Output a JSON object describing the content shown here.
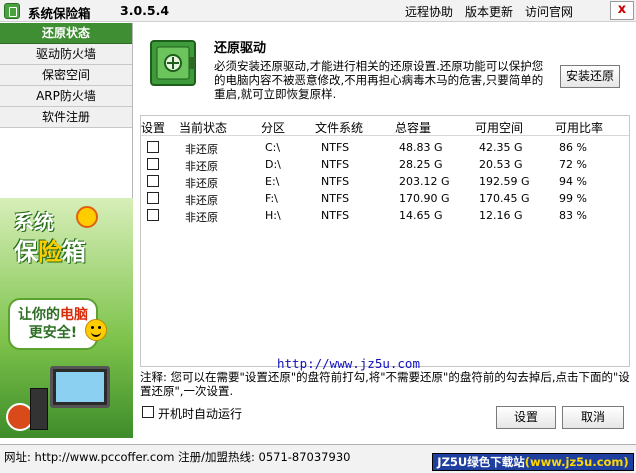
{
  "app": {
    "title": "系统保险箱",
    "version": "3.0.5.4",
    "links": [
      "远程协助",
      "版本更新",
      "访问官网"
    ],
    "close_label": "x"
  },
  "sidebar": {
    "items": [
      {
        "label": "还原状态",
        "active": true
      },
      {
        "label": "驱动防火墙",
        "active": false
      },
      {
        "label": "保密空间",
        "active": false
      },
      {
        "label": "ARP防火墙",
        "active": false
      },
      {
        "label": "软件注册",
        "active": false
      }
    ],
    "promo": {
      "title_line1": "系统",
      "title_line2_a": "保",
      "title_line2_b": "险",
      "title_line2_c": "箱",
      "slogan_line1_a": "让你的",
      "slogan_line1_b": "电脑",
      "slogan_line2": "更安全!"
    }
  },
  "main": {
    "heading": "还原驱动",
    "description": "必须安装还原驱动,才能进行相关的还原设置.还原功能可以保护您的电脑内容不被恶意修改,不用再担心病毒木马的危害,只要简单的重启,就可立即恢复原样.",
    "install_button": "安装还原",
    "table": {
      "headers": [
        "设置",
        "当前状态",
        "分区",
        "文件系统",
        "总容量",
        "可用空间",
        "可用比率"
      ],
      "rows": [
        {
          "checked": false,
          "status": "非还原",
          "drive": "C:\\",
          "fs": "NTFS",
          "total": "48.83 G",
          "free": "42.35 G",
          "ratio": "86 %"
        },
        {
          "checked": false,
          "status": "非还原",
          "drive": "D:\\",
          "fs": "NTFS",
          "total": "28.25 G",
          "free": "20.53 G",
          "ratio": "72 %"
        },
        {
          "checked": false,
          "status": "非还原",
          "drive": "E:\\",
          "fs": "NTFS",
          "total": "203.12 G",
          "free": "192.59 G",
          "ratio": "94 %"
        },
        {
          "checked": false,
          "status": "非还原",
          "drive": "F:\\",
          "fs": "NTFS",
          "total": "170.90 G",
          "free": "170.45 G",
          "ratio": "99 %"
        },
        {
          "checked": false,
          "status": "非还原",
          "drive": "H:\\",
          "fs": "NTFS",
          "total": "14.65 G",
          "free": "12.16 G",
          "ratio": "83 %"
        }
      ]
    },
    "url_text": "http://www.jz5u.com",
    "note": "注释: 您可以在需要\"设置还原\"的盘符前打勾,将\"不需要还原\"的盘符前的勾去掉后,点击下面的\"设置还原\",一次设置.",
    "autorun_label": "开机时自动运行",
    "autorun_checked": false,
    "settings_button": "设置",
    "cancel_button": "取消"
  },
  "statusbar": {
    "text": "网址: http://www.pccoffer.com  注册/加盟热线: 0571-87037930",
    "promo_a": "JZ5U绿色下载站",
    "promo_b": "(www.jz5u.com)"
  },
  "icons": {
    "app": "safe-icon",
    "main": "safe-cabinet-icon",
    "checkbox": "checkbox-icon"
  },
  "colors": {
    "sidebar_active": "#3f8e33",
    "link": "#1010c0",
    "promo_bg": "#1e3ea0"
  }
}
